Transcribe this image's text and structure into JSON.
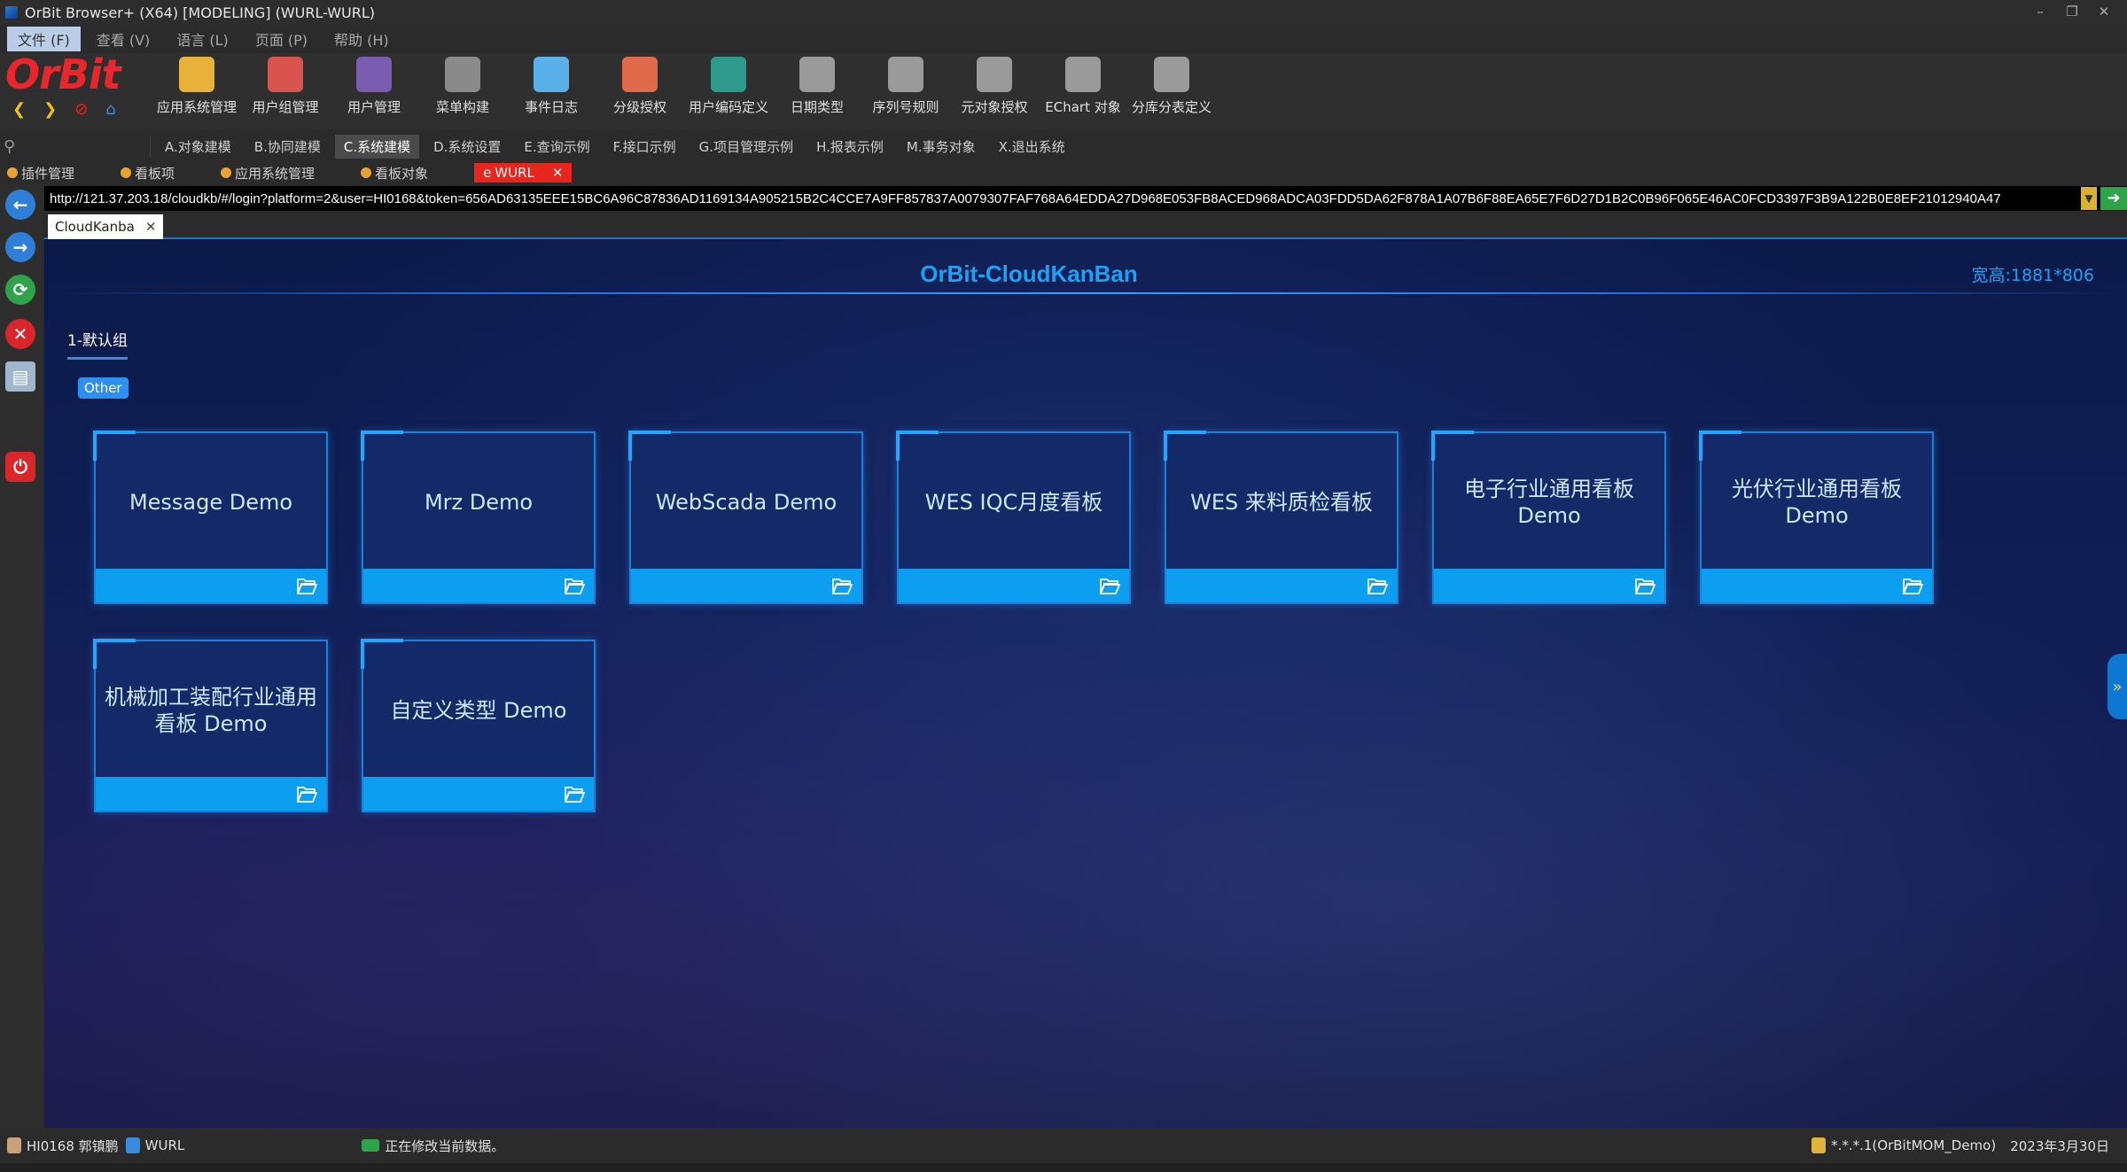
{
  "window": {
    "title": "OrBit Browser+ (X64) [MODELING] (WURL-WURL)"
  },
  "menu": [
    "文件 (F)",
    "查看 (V)",
    "语言 (L)",
    "页面 (P)",
    "帮助 (H)"
  ],
  "logo": "OrBit",
  "toolbar": [
    {
      "label": "应用系统管理",
      "icon": "gold-gears-icon",
      "color": "#e8b13a"
    },
    {
      "label": "用户组管理",
      "icon": "users-group-icon",
      "color": "#d9534f"
    },
    {
      "label": "用户管理",
      "icon": "user-icon",
      "color": "#7a5cb0"
    },
    {
      "label": "菜单构建",
      "icon": "menu-document-icon",
      "color": "#8a8a8a"
    },
    {
      "label": "事件日志",
      "icon": "magnifier-log-icon",
      "color": "#5ab0e8"
    },
    {
      "label": "分级授权",
      "icon": "grant-users-icon",
      "color": "#e06a4a"
    },
    {
      "label": "用户编码定义",
      "icon": "book-icon",
      "color": "#2e9a8c"
    },
    {
      "label": "日期类型",
      "icon": "calendar-doc-icon",
      "color": "#9a9a9a"
    },
    {
      "label": "序列号规则",
      "icon": "sequence-doc-icon",
      "color": "#9a9a9a"
    },
    {
      "label": "元对象授权",
      "icon": "object-doc-icon",
      "color": "#9a9a9a"
    },
    {
      "label": "EChart 对象",
      "icon": "chart-doc-icon",
      "color": "#9a9a9a"
    },
    {
      "label": "分库分表定义",
      "icon": "database-doc-icon",
      "color": "#9a9a9a"
    }
  ],
  "modules": [
    "A.对象建模",
    "B.协同建模",
    "C.系统建模",
    "D.系统设置",
    "E.查询示例",
    "F.接口示例",
    "G.项目管理示例",
    "H.报表示例",
    "M.事务对象",
    "X.退出系统"
  ],
  "active_module": "C.系统建模",
  "favorites": [
    "插件管理",
    "看板项",
    "应用系统管理",
    "看板对象"
  ],
  "open_tab": {
    "label": "WURL",
    "close": "✕"
  },
  "url": "http://121.37.203.18/cloudkb/#/login?platform=2&user=HI0168&token=656AD63135EEE15BC6A96C87836AD1169134A905215B2C4CCE7A9FF857837A0079307FAF768A64EDDA27D968E053FB8ACED968ADCA03FDD5DA62F878A1A07B6F88EA65E7F6D27D1B2C0B96F065E46AC0FCD3397F3B9A122B0E8EF21012940A47",
  "browser_tab": {
    "label": "CloudKanba",
    "close": "✕"
  },
  "kanban": {
    "title": "OrBit-CloudKanBan",
    "size_text": "宽高:1881*806",
    "group_tab": "1-默认组",
    "category_badge": "Other",
    "cards": [
      "Message Demo",
      "Mrz Demo",
      "WebScada Demo",
      "WES IQC月度看板",
      "WES 来料质检看板",
      "电子行业通用看板 Demo",
      "光伏行业通用看板 Demo",
      "机械加工装配行业通用看板 Demo",
      "自定义类型 Demo"
    ],
    "side_handle": "»"
  },
  "status": {
    "user": "HI0168 郭镇鹏",
    "page": "WURL",
    "message": "正在修改当前数据。",
    "db": "*.*.*.1(OrBitMOM_Demo)",
    "date": "2023年3月30日"
  },
  "colors": {
    "accent": "#1aa3f5",
    "card_footer": "#0c9ef0",
    "close_tab": "#e8261e"
  }
}
